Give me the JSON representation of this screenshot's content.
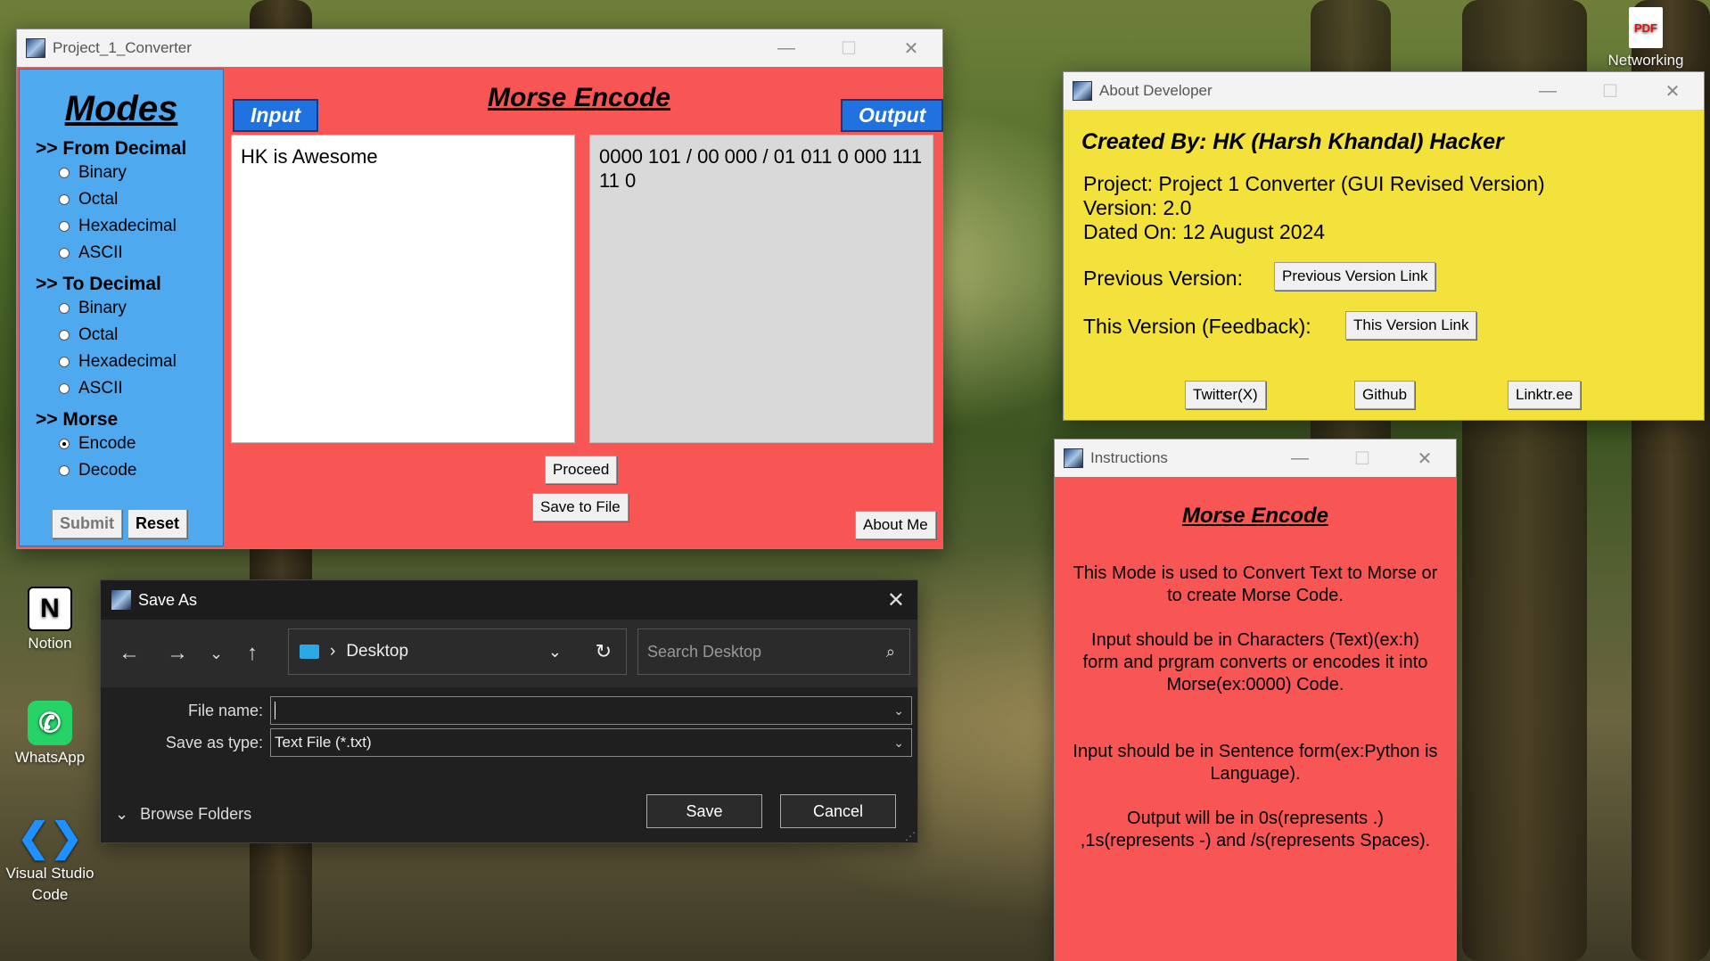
{
  "desktop": {
    "icons": [
      {
        "label": "Notion"
      },
      {
        "label": "WhatsApp"
      },
      {
        "label": "Visual Studio Code"
      },
      {
        "label": "Networking"
      }
    ],
    "pdf_badge": "PDF"
  },
  "converter": {
    "window_title": "Project_1_Converter",
    "modes_heading": "Modes",
    "groups": [
      {
        "label": ">> From Decimal",
        "options": [
          "Binary",
          "Octal",
          "Hexadecimal",
          "ASCII"
        ]
      },
      {
        "label": ">> To Decimal",
        "options": [
          "Binary",
          "Octal",
          "Hexadecimal",
          "ASCII"
        ]
      },
      {
        "label": ">> Morse",
        "options": [
          "Encode",
          "Decode"
        ]
      }
    ],
    "selected_option": "Encode",
    "submit_label": "Submit",
    "reset_label": "Reset",
    "title": "Morse Encode",
    "input_tag": "Input",
    "output_tag": "Output",
    "input_text": "HK is Awesome",
    "output_text": "0000 101 / 00 000 / 01 011 0 000 111 11 0",
    "proceed_label": "Proceed",
    "save_to_file_label": "Save to File",
    "about_me_label": "About Me"
  },
  "about": {
    "window_title": "About Developer",
    "created_by": "Created By: HK (Harsh Khandal) Hacker",
    "project": "Project: Project 1 Converter (GUI Revised Version)",
    "version": "Version: 2.0",
    "dated_on": "Dated On: 12 August 2024",
    "previous_version_label": "Previous Version:",
    "previous_version_button": "Previous Version Link",
    "this_version_label": "This Version (Feedback):",
    "this_version_button": "This Version Link",
    "twitter_button": "Twitter(X)",
    "github_button": "Github",
    "linktree_button": "Linktr.ee"
  },
  "instructions": {
    "window_title": "Instructions",
    "title": "Morse Encode",
    "para1": "This Mode is used to Convert Text to Morse or to create Morse Code.",
    "para2": "Input should be in Characters (Text)(ex:h) form and prgram converts or encodes it into Morse(ex:0000) Code.",
    "para3": "Input should be in Sentence form(ex:Python is Language).",
    "para4": "Output will be in 0s(represents .) ,1s(represents -) and /s(represents Spaces)."
  },
  "save_dialog": {
    "window_title": "Save As",
    "location": "Desktop",
    "search_placeholder": "Search Desktop",
    "file_name_label": "File name:",
    "file_name_value": "",
    "save_as_type_label": "Save as type:",
    "save_as_type_value": "Text File (*.txt)",
    "browse_folders_label": "Browse Folders",
    "save_label": "Save",
    "cancel_label": "Cancel"
  }
}
